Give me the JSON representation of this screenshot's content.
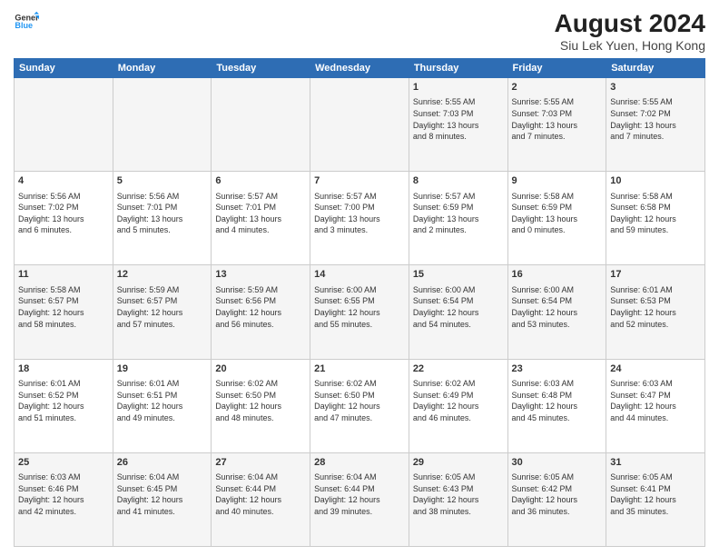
{
  "header": {
    "logo_line1": "General",
    "logo_line2": "Blue",
    "title": "August 2024",
    "subtitle": "Siu Lek Yuen, Hong Kong"
  },
  "columns": [
    "Sunday",
    "Monday",
    "Tuesday",
    "Wednesday",
    "Thursday",
    "Friday",
    "Saturday"
  ],
  "weeks": [
    [
      {
        "day": "",
        "data": ""
      },
      {
        "day": "",
        "data": ""
      },
      {
        "day": "",
        "data": ""
      },
      {
        "day": "",
        "data": ""
      },
      {
        "day": "1",
        "data": "Sunrise: 5:55 AM\nSunset: 7:03 PM\nDaylight: 13 hours\nand 8 minutes."
      },
      {
        "day": "2",
        "data": "Sunrise: 5:55 AM\nSunset: 7:03 PM\nDaylight: 13 hours\nand 7 minutes."
      },
      {
        "day": "3",
        "data": "Sunrise: 5:55 AM\nSunset: 7:02 PM\nDaylight: 13 hours\nand 7 minutes."
      }
    ],
    [
      {
        "day": "4",
        "data": "Sunrise: 5:56 AM\nSunset: 7:02 PM\nDaylight: 13 hours\nand 6 minutes."
      },
      {
        "day": "5",
        "data": "Sunrise: 5:56 AM\nSunset: 7:01 PM\nDaylight: 13 hours\nand 5 minutes."
      },
      {
        "day": "6",
        "data": "Sunrise: 5:57 AM\nSunset: 7:01 PM\nDaylight: 13 hours\nand 4 minutes."
      },
      {
        "day": "7",
        "data": "Sunrise: 5:57 AM\nSunset: 7:00 PM\nDaylight: 13 hours\nand 3 minutes."
      },
      {
        "day": "8",
        "data": "Sunrise: 5:57 AM\nSunset: 6:59 PM\nDaylight: 13 hours\nand 2 minutes."
      },
      {
        "day": "9",
        "data": "Sunrise: 5:58 AM\nSunset: 6:59 PM\nDaylight: 13 hours\nand 0 minutes."
      },
      {
        "day": "10",
        "data": "Sunrise: 5:58 AM\nSunset: 6:58 PM\nDaylight: 12 hours\nand 59 minutes."
      }
    ],
    [
      {
        "day": "11",
        "data": "Sunrise: 5:58 AM\nSunset: 6:57 PM\nDaylight: 12 hours\nand 58 minutes."
      },
      {
        "day": "12",
        "data": "Sunrise: 5:59 AM\nSunset: 6:57 PM\nDaylight: 12 hours\nand 57 minutes."
      },
      {
        "day": "13",
        "data": "Sunrise: 5:59 AM\nSunset: 6:56 PM\nDaylight: 12 hours\nand 56 minutes."
      },
      {
        "day": "14",
        "data": "Sunrise: 6:00 AM\nSunset: 6:55 PM\nDaylight: 12 hours\nand 55 minutes."
      },
      {
        "day": "15",
        "data": "Sunrise: 6:00 AM\nSunset: 6:54 PM\nDaylight: 12 hours\nand 54 minutes."
      },
      {
        "day": "16",
        "data": "Sunrise: 6:00 AM\nSunset: 6:54 PM\nDaylight: 12 hours\nand 53 minutes."
      },
      {
        "day": "17",
        "data": "Sunrise: 6:01 AM\nSunset: 6:53 PM\nDaylight: 12 hours\nand 52 minutes."
      }
    ],
    [
      {
        "day": "18",
        "data": "Sunrise: 6:01 AM\nSunset: 6:52 PM\nDaylight: 12 hours\nand 51 minutes."
      },
      {
        "day": "19",
        "data": "Sunrise: 6:01 AM\nSunset: 6:51 PM\nDaylight: 12 hours\nand 49 minutes."
      },
      {
        "day": "20",
        "data": "Sunrise: 6:02 AM\nSunset: 6:50 PM\nDaylight: 12 hours\nand 48 minutes."
      },
      {
        "day": "21",
        "data": "Sunrise: 6:02 AM\nSunset: 6:50 PM\nDaylight: 12 hours\nand 47 minutes."
      },
      {
        "day": "22",
        "data": "Sunrise: 6:02 AM\nSunset: 6:49 PM\nDaylight: 12 hours\nand 46 minutes."
      },
      {
        "day": "23",
        "data": "Sunrise: 6:03 AM\nSunset: 6:48 PM\nDaylight: 12 hours\nand 45 minutes."
      },
      {
        "day": "24",
        "data": "Sunrise: 6:03 AM\nSunset: 6:47 PM\nDaylight: 12 hours\nand 44 minutes."
      }
    ],
    [
      {
        "day": "25",
        "data": "Sunrise: 6:03 AM\nSunset: 6:46 PM\nDaylight: 12 hours\nand 42 minutes."
      },
      {
        "day": "26",
        "data": "Sunrise: 6:04 AM\nSunset: 6:45 PM\nDaylight: 12 hours\nand 41 minutes."
      },
      {
        "day": "27",
        "data": "Sunrise: 6:04 AM\nSunset: 6:44 PM\nDaylight: 12 hours\nand 40 minutes."
      },
      {
        "day": "28",
        "data": "Sunrise: 6:04 AM\nSunset: 6:44 PM\nDaylight: 12 hours\nand 39 minutes."
      },
      {
        "day": "29",
        "data": "Sunrise: 6:05 AM\nSunset: 6:43 PM\nDaylight: 12 hours\nand 38 minutes."
      },
      {
        "day": "30",
        "data": "Sunrise: 6:05 AM\nSunset: 6:42 PM\nDaylight: 12 hours\nand 36 minutes."
      },
      {
        "day": "31",
        "data": "Sunrise: 6:05 AM\nSunset: 6:41 PM\nDaylight: 12 hours\nand 35 minutes."
      }
    ]
  ]
}
